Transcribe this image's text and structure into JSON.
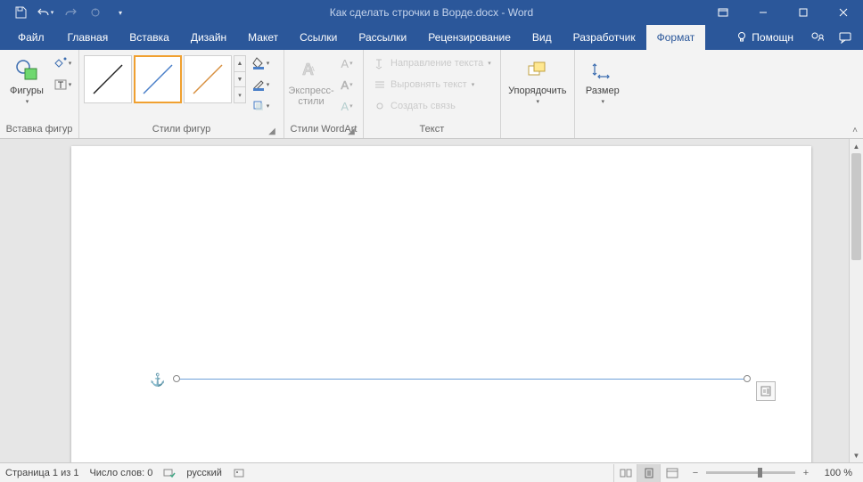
{
  "title": "Как сделать строчки в Ворде.docx - Word",
  "qat": {
    "save": "save",
    "undo": "undo",
    "redo": "redo",
    "start": "start"
  },
  "tabs": {
    "file": "Файл",
    "home": "Главная",
    "insert": "Вставка",
    "design": "Дизайн",
    "layout": "Макет",
    "references": "Ссылки",
    "mailings": "Рассылки",
    "review": "Рецензирование",
    "view": "Вид",
    "developer": "Разработчик",
    "format": "Формат"
  },
  "tell_me": "Помощн",
  "ribbon": {
    "insert_shapes": {
      "shapes": "Фигуры",
      "group": "Вставка фигур"
    },
    "shape_styles": {
      "group": "Стили фигур"
    },
    "wordart_styles": {
      "quick": "Экспресс-стили",
      "group": "Стили WordArt"
    },
    "text": {
      "direction": "Направление текста",
      "align": "Выровнять текст",
      "link": "Создать связь",
      "group": "Текст"
    },
    "arrange": {
      "label": "Упорядочить",
      "group": ""
    },
    "size": {
      "label": "Размер",
      "group": ""
    }
  },
  "statusbar": {
    "page": "Страница 1 из 1",
    "words": "Число слов: 0",
    "language": "русский",
    "zoom": "100 %"
  }
}
